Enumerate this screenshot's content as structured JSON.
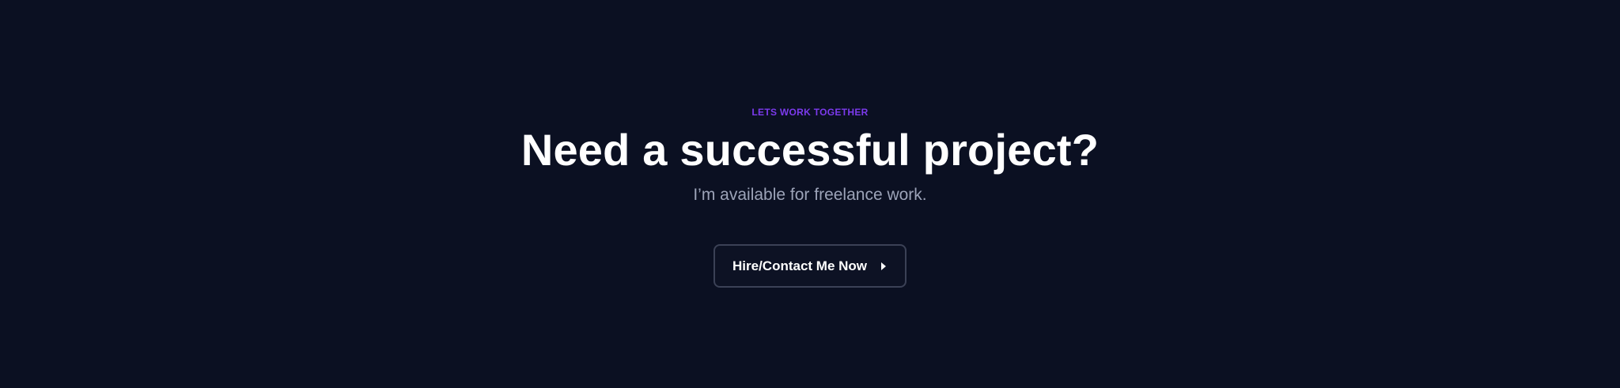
{
  "cta": {
    "eyebrow": "LETS WORK TOGETHER",
    "headline": "Need a successful project?",
    "subline": "I’m available for freelance work.",
    "button": {
      "label": "Hire/Contact Me Now",
      "icon": "caret-right-icon"
    }
  },
  "colors": {
    "background": "#0b1022",
    "accent": "#7c3aed",
    "headline": "#ffffff",
    "subtext": "#9ca3b8",
    "button_border": "#3b4156"
  }
}
